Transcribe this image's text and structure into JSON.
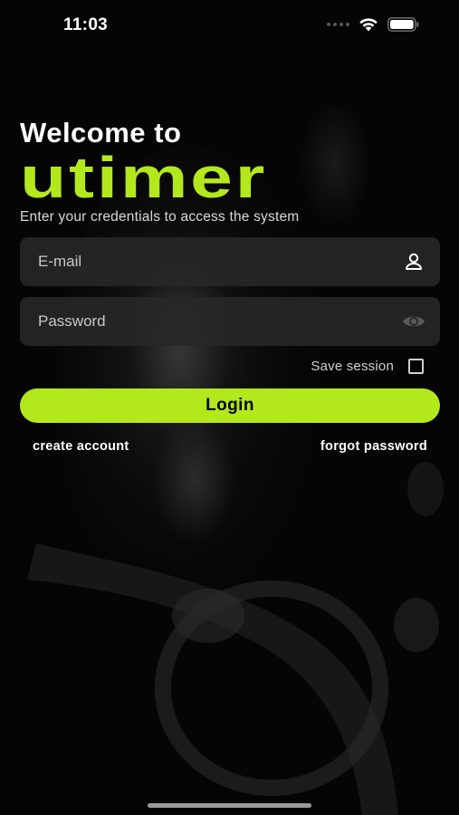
{
  "status_bar": {
    "time": "11:03"
  },
  "header": {
    "welcome": "Welcome to",
    "brand": "utimer",
    "subtitle": "Enter your credentials to access the system"
  },
  "form": {
    "email_placeholder": "E-mail",
    "email_value": "",
    "password_placeholder": "Password",
    "password_value": "",
    "save_session_label": "Save session",
    "save_session_checked": false,
    "login_label": "Login"
  },
  "links": {
    "create_account": "create account",
    "forgot_password": "forgot password"
  },
  "icons": {
    "email_field": "user-icon",
    "password_field": "eye-icon"
  },
  "colors": {
    "accent": "#b3e81d",
    "background": "#050505",
    "field": "#282828"
  }
}
